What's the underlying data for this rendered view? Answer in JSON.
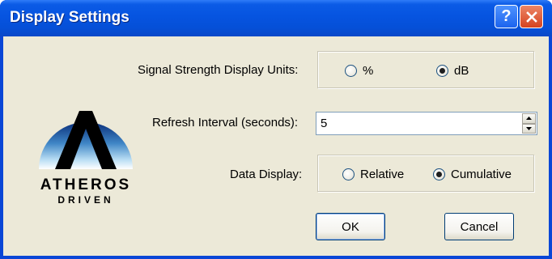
{
  "window": {
    "title": "Display Settings",
    "help_symbol": "?",
    "close_symbol": "×"
  },
  "logo": {
    "brand_text": "ATHEROS",
    "sub_text": "DRIVEN"
  },
  "signal_units": {
    "label": "Signal Strength Display Units:",
    "options": [
      {
        "label": "%",
        "selected": false
      },
      {
        "label": "dB",
        "selected": true
      }
    ]
  },
  "refresh": {
    "label": "Refresh Interval (seconds):",
    "value": "5"
  },
  "data_display": {
    "label": "Data Display:",
    "options": [
      {
        "label": "Relative",
        "selected": false
      },
      {
        "label": "Cumulative",
        "selected": true
      }
    ]
  },
  "buttons": {
    "ok": "OK",
    "cancel": "Cancel"
  },
  "colors": {
    "titlebar": "#0654e0",
    "dialog_bg": "#ece9d8",
    "close_red": "#d6431e"
  }
}
